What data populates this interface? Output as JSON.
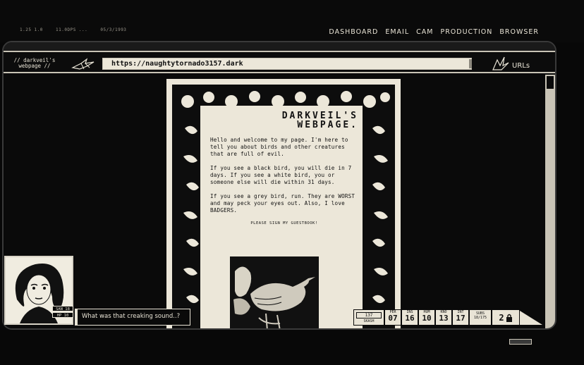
{
  "topbar": {
    "version": "1.25 1.0",
    "fps": "11.0DPS ...",
    "date": "05/3/1993"
  },
  "nav": {
    "items": [
      "DASHBOARD",
      "EMAIL",
      "CAM",
      "PRODUCTION",
      "BROWSER"
    ]
  },
  "browser": {
    "site_title": "// darkveil's webpage //",
    "url": "https://naughtytornado3157.dark",
    "urls_label": "URLs"
  },
  "webpage": {
    "heading_line1": "DARKVEIL'S",
    "heading_line2": "WEBPAGE.",
    "paragraphs": [
      "Hello and welcome to my page. I'm here to tell you about birds and other creatures that are full of evil.",
      "If you see a black bird, you will die in 7 days. If you see a white bird, you or someone else will die within 31 days.",
      "If you see a grey bird, run. They are WORST and may peck your eyes out. Also, I love BADGERS."
    ],
    "guestbook_link": "PLEASE SIGN MY GUESTBOOK!"
  },
  "character": {
    "san": "SAN 18",
    "hp": "HP 10",
    "dialogue": "What was that creaking sound..?"
  },
  "hud": {
    "skash_value": "137",
    "skash_label": "SKASH",
    "stats": [
      {
        "label": "PER",
        "value": "07"
      },
      {
        "label": "INS",
        "value": "16"
      },
      {
        "label": "HUM",
        "value": "10"
      },
      {
        "label": "KNO",
        "value": "13"
      },
      {
        "label": "INT",
        "value": "17"
      }
    ],
    "subs_label": "SUBS",
    "subs_value": "18/175",
    "subs_icon_value": "2"
  },
  "colors": {
    "background": "#0a0a0a",
    "paper": "#ece7d9",
    "ink": "#111111"
  }
}
